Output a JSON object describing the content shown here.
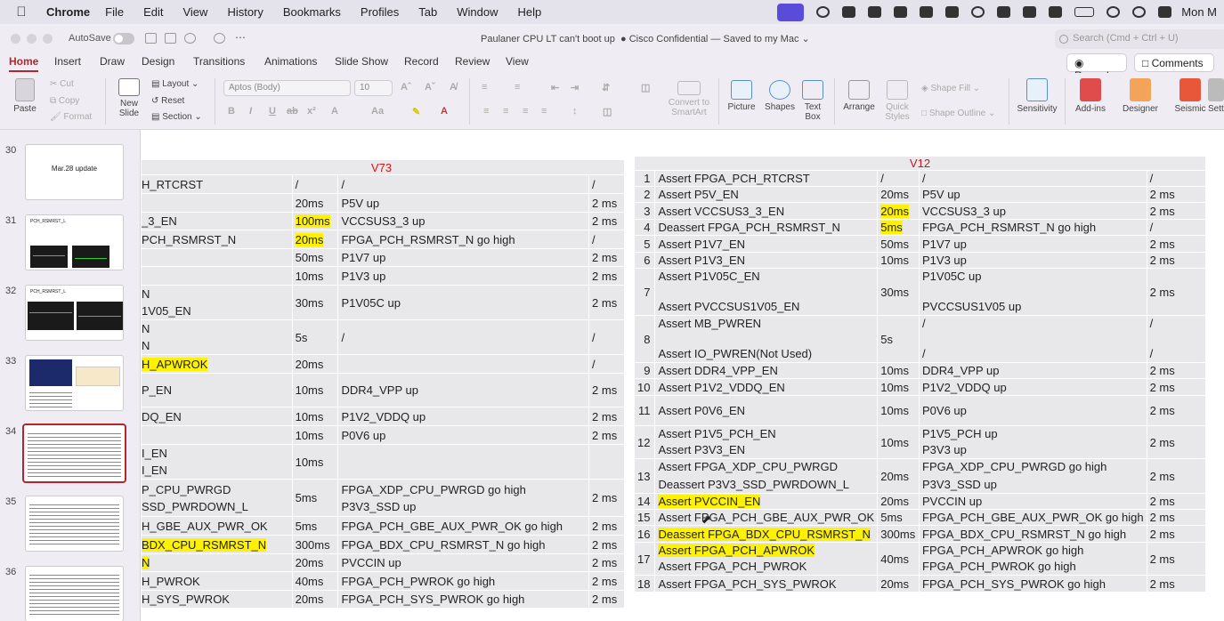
{
  "menubar": {
    "app": "Chrome",
    "menus": [
      "File",
      "Edit",
      "View",
      "History",
      "Bookmarks",
      "Profiles",
      "Tab",
      "Window",
      "Help"
    ],
    "clock": "Mon M"
  },
  "window": {
    "autosave": "AutoSave",
    "title_left": "Paulaner CPU LT can't boot up",
    "title_right": "Cisco Confidential — Saved to my Mac",
    "search_placeholder": "Search (Cmd + Ctrl + U)"
  },
  "tabs": [
    "Home",
    "Insert",
    "Draw",
    "Design",
    "Transitions",
    "Animations",
    "Slide Show",
    "Record",
    "Review",
    "View"
  ],
  "actions": {
    "record": "Record",
    "comments": "Comments"
  },
  "ribbon": {
    "paste": "Paste",
    "cut": "Cut",
    "copy": "Copy",
    "format": "Format",
    "new_slide": "New Slide",
    "layout": "Layout",
    "reset": "Reset",
    "section": "Section",
    "font": "Aptos (Body)",
    "size": "10",
    "convert": "Convert to SmartArt",
    "picture": "Picture",
    "shapes": "Shapes",
    "textbox": "Text Box",
    "arrange": "Arrange",
    "quickstyles": "Quick Styles",
    "shapefill": "Shape Fill",
    "shapeoutline": "Shape Outline",
    "sensitivity": "Sensitivity",
    "addins": "Add-ins",
    "designer": "Designer",
    "seismic": "Seismic",
    "settings": "Setti"
  },
  "slides": [
    {
      "num": "30",
      "label": "Mar.28 update"
    },
    {
      "num": "31",
      "label": "PCH_RSMRST_L"
    },
    {
      "num": "32",
      "label": "PCH_RSMRST_L"
    },
    {
      "num": "33",
      "label": ""
    },
    {
      "num": "34",
      "label": ""
    },
    {
      "num": "35",
      "label": ""
    },
    {
      "num": "36",
      "label": ""
    }
  ],
  "v73": {
    "title": "V73",
    "rows": [
      {
        "sig": "H_RTCRST",
        "t": "/",
        "desc": "/",
        "d": "/"
      },
      {
        "sig": "",
        "t": "20ms",
        "desc": "P5V up",
        "d": "2 ms"
      },
      {
        "sig": "_3_EN",
        "t": "100ms",
        "desc": "VCCSUS3_3 up",
        "d": "2 ms"
      },
      {
        "sig": "PCH_RSMRST_N",
        "t": "20ms",
        "desc": "FPGA_PCH_RSMRST_N go high",
        "d": "/"
      },
      {
        "sig": "",
        "t": "50ms",
        "desc": "P1V7 up",
        "d": "2 ms"
      },
      {
        "sig": "",
        "t": "10ms",
        "desc": "P1V3 up",
        "d": "2 ms"
      },
      {
        "sig": "N",
        "sig2": "1V05_EN",
        "t": "30ms",
        "desc": "P1V05C up",
        "d": "2 ms"
      },
      {
        "sig": "N",
        "sig2": "N",
        "t": "5s",
        "desc": "/",
        "d": "/"
      },
      {
        "sig": "H_APWROK",
        "t": "20ms",
        "desc": "",
        "d": "/"
      },
      {
        "sig": "P_EN",
        "t": "10ms",
        "desc": "DDR4_VPP up",
        "d": "2 ms"
      },
      {
        "sig": "DQ_EN",
        "t": "10ms",
        "desc": "P1V2_VDDQ up",
        "d": "2 ms"
      },
      {
        "sig": "",
        "t": "10ms",
        "desc": "P0V6 up",
        "d": "2 ms"
      },
      {
        "sig": "I_EN",
        "sig2": "I_EN",
        "t": "10ms",
        "desc": "",
        "d": ""
      },
      {
        "sig": "P_CPU_PWRGD",
        "sig2": "SSD_PWRDOWN_L",
        "t": "5ms",
        "desc": "FPGA_XDP_CPU_PWRGD go high",
        "desc2": "P3V3_SSD up",
        "d": "2 ms"
      },
      {
        "sig": "H_GBE_AUX_PWR_OK",
        "t": "5ms",
        "desc": "FPGA_PCH_GBE_AUX_PWR_OK go high",
        "d": "2 ms"
      },
      {
        "sig": "BDX_CPU_RSMRST_N",
        "t": "300ms",
        "desc": "FPGA_BDX_CPU_RSMRST_N go high",
        "d": "2 ms"
      },
      {
        "sig": "N",
        "t": "20ms",
        "desc": "PVCCIN up",
        "d": "2 ms"
      },
      {
        "sig": "H_PWROK",
        "t": "40ms",
        "desc": "FPGA_PCH_PWROK go high",
        "d": "2 ms"
      },
      {
        "sig": "H_SYS_PWROK",
        "t": "20ms",
        "desc": "FPGA_PCH_SYS_PWROK go high",
        "d": "2 ms"
      }
    ]
  },
  "v12": {
    "title": "V12",
    "rows": [
      {
        "n": "1",
        "sig": "Assert FPGA_PCH_RTCRST",
        "t": "/",
        "desc": "/",
        "d": "/"
      },
      {
        "n": "2",
        "sig": "Assert P5V_EN",
        "t": "20ms",
        "desc": "P5V up",
        "d": "2 ms"
      },
      {
        "n": "3",
        "sig": "Assert VCCSUS3_3_EN",
        "t": "20ms",
        "desc": "VCCSUS3_3 up",
        "d": "2 ms"
      },
      {
        "n": "4",
        "sig": "Deassert FPGA_PCH_RSMRST_N",
        "t": "5ms",
        "desc": "FPGA_PCH_RSMRST_N go high",
        "d": "/"
      },
      {
        "n": "5",
        "sig": "Assert P1V7_EN",
        "t": "50ms",
        "desc": "P1V7 up",
        "d": "2 ms"
      },
      {
        "n": "6",
        "sig": "Assert P1V3_EN",
        "t": "10ms",
        "desc": "P1V3 up",
        "d": "2 ms"
      },
      {
        "n": "7",
        "sig": "Assert P1V05C_EN",
        "sig2": "Assert PVCCSUS1V05_EN",
        "t": "30ms",
        "desc": "P1V05C up",
        "desc2": "PVCCSUS1V05 up",
        "d": "2 ms"
      },
      {
        "n": "8",
        "sig": "Assert MB_PWREN",
        "sig2": "Assert IO_PWREN(Not Used)",
        "t": "5s",
        "desc": "/",
        "desc2": "/",
        "d": "/",
        "d2": "/"
      },
      {
        "n": "9",
        "sig": "Assert DDR4_VPP_EN",
        "t": "10ms",
        "desc": "DDR4_VPP up",
        "d": "2 ms"
      },
      {
        "n": "10",
        "sig": "Assert P1V2_VDDQ_EN",
        "t": "10ms",
        "desc": "P1V2_VDDQ up",
        "d": "2 ms"
      },
      {
        "n": "11",
        "sig": "Assert P0V6_EN",
        "t": "10ms",
        "desc": "P0V6 up",
        "d": "2 ms"
      },
      {
        "n": "12",
        "sig": "Assert P1V5_PCH_EN",
        "sig2": "Assert P3V3_EN",
        "t": "10ms",
        "desc": "P1V5_PCH up",
        "desc2": "P3V3 up",
        "d": "2 ms"
      },
      {
        "n": "13",
        "sig": "Assert FPGA_XDP_CPU_PWRGD",
        "sig2": "Deassert P3V3_SSD_PWRDOWN_L",
        "t": "20ms",
        "desc": "FPGA_XDP_CPU_PWRGD go high",
        "desc2": "P3V3_SSD up",
        "d": "2 ms"
      },
      {
        "n": "14",
        "sig": "Assert PVCCIN_EN",
        "t": "20ms",
        "desc": "PVCCIN up",
        "d": "2 ms"
      },
      {
        "n": "15",
        "sig": "Assert FPGA_PCH_GBE_AUX_PWR_OK",
        "t": "5ms",
        "desc": "FPGA_PCH_GBE_AUX_PWR_OK go high",
        "d": "2 ms"
      },
      {
        "n": "16",
        "sig": "Deassert FPGA_BDX_CPU_RSMRST_N",
        "t": "300ms",
        "desc": "FPGA_BDX_CPU_RSMRST_N go high",
        "d": "2 ms"
      },
      {
        "n": "17",
        "sig": "Assert FPGA_PCH_APWROK",
        "sig2": "Assert FPGA_PCH_PWROK",
        "t": "40ms",
        "desc": "FPGA_PCH_APWROK go high",
        "desc2": "FPGA_PCH_PWROK go high",
        "d": "2 ms"
      },
      {
        "n": "18",
        "sig": "Assert FPGA_PCH_SYS_PWROK",
        "t": "20ms",
        "desc": "FPGA_PCH_SYS_PWROK go high",
        "d": "2 ms"
      }
    ]
  },
  "colors": {
    "accent": "#b4262c",
    "header_red": "#d0141a",
    "highlight": "#fff200",
    "table_bg": "#e8e8ea"
  }
}
